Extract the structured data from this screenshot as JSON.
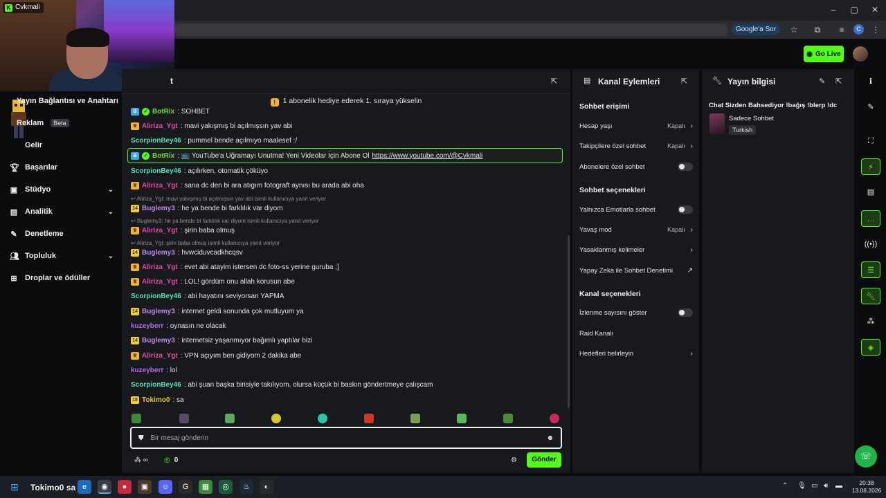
{
  "stream_badge": "Cvkmali",
  "browser": {
    "google_chip": "Google'a Sor",
    "profile_letter": "C"
  },
  "header": {
    "go_live": "Go Live"
  },
  "sidebar": {
    "items": [
      {
        "label": "Yayın Bağlantısı ve Anahtarı"
      },
      {
        "label": "Reklam",
        "badge": "Beta"
      },
      {
        "label": "Gelir"
      },
      {
        "label": "Başarılar"
      },
      {
        "label": "Stüdyo"
      },
      {
        "label": "Analitik"
      },
      {
        "label": "Denetleme"
      },
      {
        "label": "Topluluk"
      },
      {
        "label": "Droplar ve ödüller"
      }
    ]
  },
  "chat": {
    "title": "t",
    "pinned": "1 abonelik hediye ederek 1. sıraya yükselin",
    "messages": [
      {
        "user": "BotRix",
        "text": ": SOHBET",
        "color": "#7ddc3c"
      },
      {
        "user": "Aliriza_Ygt",
        "text": ": mavi yakışmış bi açılmışsın yav abi",
        "color": "#e24aa8"
      },
      {
        "user": "ScorpionBey46",
        "text": ": pummel bende açılmıyo maalesef :/",
        "color": "#5ce0b0"
      },
      {
        "user": "BotRix",
        "text": ": 📺 YouTube'a Uğramayı Unutma! Yeni Videolar İçin Abone Ol",
        "link": "https://www.youtube.com/@Cvkmali",
        "color": "#7ddc3c"
      },
      {
        "user": "ScorpionBey46",
        "text": ": açılırken, otomatik çöküyo",
        "color": "#5ce0b0"
      },
      {
        "user": "Aliriza_Ygt",
        "text": ": sana dc den bi ara atıgım fotograft aynısı bu arada abi oha",
        "color": "#e24aa8"
      },
      {
        "reply": "Aliriza_Ygt: mavi yakışmış bi açılmışsın yav abi isimli kullanıcıya yanıt veriyor"
      },
      {
        "user": "Buglemy3",
        "text": ": he ya bende bi farklılık var diyom",
        "color": "#c08af0"
      },
      {
        "reply": "Buglemy3: he ya bende bi farklılık var diyom isimli kullanıcıya yanıt veriyor"
      },
      {
        "user": "Aliriza_Ygt",
        "text": ": şirin baba olmuş",
        "color": "#e24aa8"
      },
      {
        "reply": "Aliriza_Ygt: şirin baba olmuş isimli kullanıcıya yanıt veriyor"
      },
      {
        "user": "Buglemy3",
        "text": ": hvwciduvcadkhcqsv",
        "color": "#c08af0"
      },
      {
        "user": "Aliriza_Ygt",
        "text": ": evet abi atayim istersen dc foto-ss yerine guruba ;]",
        "color": "#e24aa8"
      },
      {
        "user": "Aliriza_Ygt",
        "text": ": LOL! gördüm onu allah korusun abe",
        "color": "#e24aa8"
      },
      {
        "user": "ScorpionBey46",
        "text": ": abi hayatını seviyorsan YAPMA",
        "color": "#5ce0b0"
      },
      {
        "user": "Buglemy3",
        "text": ": internet geldi sonunda çok mutluyum ya",
        "color": "#c08af0"
      },
      {
        "user": "kuzeyberr",
        "text": ": oynasın ne olacak",
        "color": "#b26af0"
      },
      {
        "user": "Buglemy3",
        "text": ": internetsiz yaşanmıyor bağımlı yaptılar bizi",
        "color": "#c08af0"
      },
      {
        "user": "Aliriza_Ygt",
        "text": ": VPN açıyım ben gidiyom 2 dakika abe",
        "color": "#e24aa8"
      },
      {
        "user": "kuzeyberr",
        "text": ": lol",
        "color": "#b26af0"
      },
      {
        "user": "ScorpionBey46",
        "text": ": abi şuan başka birisiyle takılıyom, olursa küçük bi baskın göndertmeye çalışcam",
        "color": "#5ce0b0"
      },
      {
        "user": "Tokimo0",
        "text": ": sa",
        "color": "#e2c23c"
      }
    ],
    "input_placeholder": "Bir mesaj gönderin",
    "points": "0",
    "send": "Gönder"
  },
  "actions": {
    "title": "Kanal Eylemleri",
    "sections": {
      "access": "Sohbet erişimi",
      "options": "Sohbet seçenekleri",
      "channel": "Kanal seçenekleri"
    },
    "items": {
      "account_age": {
        "label": "Hesap yaşı",
        "value": "Kapalı"
      },
      "followers_only": {
        "label": "Takipçilere özel sohbet",
        "value": "Kapalı"
      },
      "subs_only": {
        "label": "Abonelere özel sohbet"
      },
      "emotes_only": {
        "label": "Yalnızca Emotlarla sohbet"
      },
      "slow_mode": {
        "label": "Yavaş mod",
        "value": "Kapalı"
      },
      "banned_words": {
        "label": "Yasaklanmış kelimeler"
      },
      "ai_moderation": {
        "label": "Yapay Zeka ile Sohbet Denetimi"
      },
      "show_viewers": {
        "label": "İzlenme sayısını göster"
      },
      "raid": {
        "label": "Raid Kanalı"
      },
      "goals": {
        "label": "Hedefleri belirleyin"
      }
    }
  },
  "info": {
    "title": "Yayın bilgisi",
    "stream_title": "Chat Sizden Bahsediyor !bağış !blerp !dc",
    "category": "Sadece Sohbet",
    "tag": "Turkish"
  },
  "taskbar": {
    "overlay": "Tokimo0  sa",
    "time": "20:38",
    "date": "13.08.2026"
  }
}
